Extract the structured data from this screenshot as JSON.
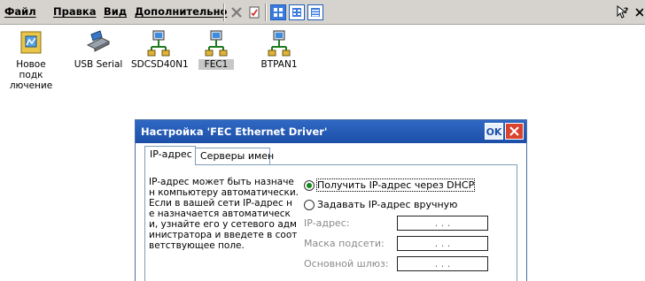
{
  "menu": {
    "items": [
      "Файл",
      "Правка",
      "Вид",
      "Дополнительно"
    ]
  },
  "toolbar": {
    "buttons": [
      "delete-icon",
      "properties-icon",
      "large-icons-view-icon",
      "small-icons-view-icon",
      "list-view-icon"
    ],
    "help": "help-icon",
    "close": "close-icon"
  },
  "desktop": {
    "icons": [
      {
        "label": "Новое подк\nлючение",
        "icon": "new-connection-icon"
      },
      {
        "label": "USB Serial",
        "icon": "usb-laptop-icon"
      },
      {
        "label": "SDCSD40N1",
        "icon": "network-adapter-icon"
      },
      {
        "label": "FEC1",
        "icon": "network-adapter-icon",
        "selected": true
      },
      {
        "label": "BTPAN1",
        "icon": "network-adapter-icon"
      }
    ]
  },
  "dialog": {
    "title": "Настройка 'FEC Ethernet Driver'",
    "ok_label": "OK",
    "tabs": [
      {
        "label": "IP-адрес",
        "active": true
      },
      {
        "label": "Серверы имен",
        "active": false
      }
    ],
    "description": "IP-адрес может быть назначе н компьютеру автоматически. Если в вашей сети IP-адрес н е назначается автоматическ и, узнайте его у сетевого адм инистратора и введете в соот ветствующее поле.",
    "description_lines": [
      "IP-адрес может быть назначе",
      "н компьютеру автоматически.",
      "Если в вашей сети IP-адрес н",
      "е назначается автоматическ",
      "и, узнайте его у сетевого адм",
      "инистратора и введете в соот",
      "ветствующее поле."
    ],
    "radio_dhcp": "Получить IP-адрес через DHCP",
    "radio_manual": "Задавать IP-адрес вручную",
    "dhcp_selected": true,
    "fields": [
      {
        "label": "IP-адрес:",
        "value": ". . ."
      },
      {
        "label": "Маска подсети:",
        "value": ". . ."
      },
      {
        "label": "Основной шлюз:",
        "value": ". . ."
      }
    ]
  }
}
